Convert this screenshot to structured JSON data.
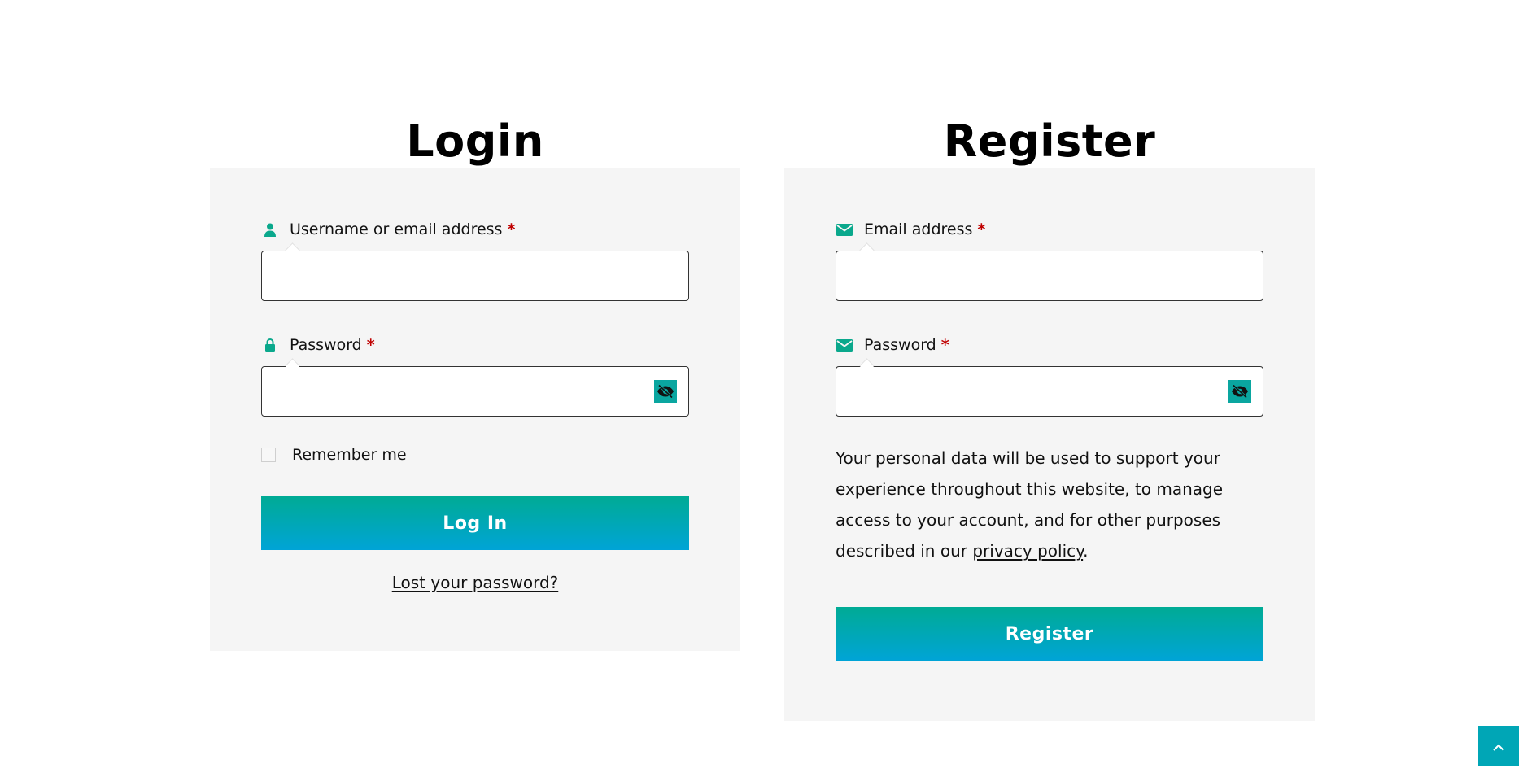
{
  "login": {
    "heading": "Login",
    "username": {
      "label": "Username or email address",
      "required_marker": "*",
      "icon": "user-icon",
      "value": "",
      "placeholder": ""
    },
    "password": {
      "label": "Password",
      "required_marker": "*",
      "icon": "lock-icon",
      "value": "",
      "placeholder": "",
      "toggle_icon": "eye-slash-icon"
    },
    "remember": {
      "label": "Remember me",
      "checked": false
    },
    "submit_label": "Log In",
    "lost_password_label": "Lost your password?"
  },
  "register": {
    "heading": "Register",
    "email": {
      "label": "Email address",
      "required_marker": "*",
      "icon": "envelope-icon",
      "value": "",
      "placeholder": ""
    },
    "password": {
      "label": "Password",
      "required_marker": "*",
      "icon": "envelope-icon",
      "value": "",
      "placeholder": "",
      "toggle_icon": "eye-slash-icon"
    },
    "privacy": {
      "text_before": "Your personal data will be used to support your experience throughout this website, to manage access to your account, and for other purposes described in our ",
      "link_label": "privacy policy",
      "text_after": "."
    },
    "submit_label": "Register"
  },
  "back_to_top": {
    "icon": "chevron-up-icon"
  },
  "colors": {
    "accent_teal": "#00ab94",
    "accent_blue": "#00a4d6",
    "icon_green": "#0aa88c",
    "required_red": "#c00000",
    "card_background": "#f5f5f5"
  }
}
